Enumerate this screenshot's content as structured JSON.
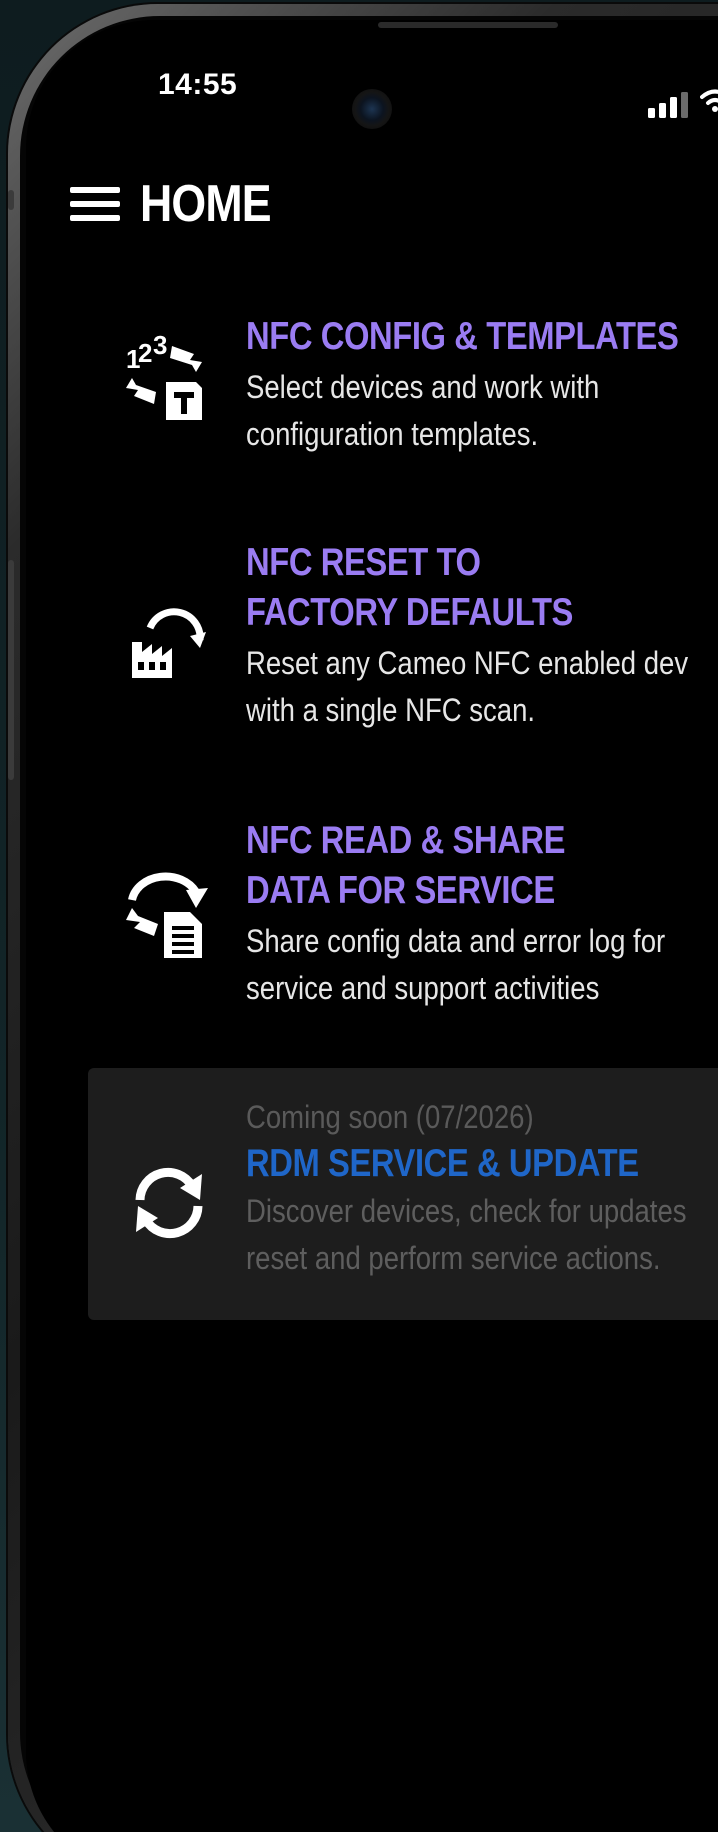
{
  "status_bar": {
    "time": "14:55"
  },
  "header": {
    "title": "HOME",
    "menu_icon": "hamburger-menu-icon"
  },
  "menu": {
    "items": [
      {
        "title": "NFC CONFIG & TEMPLATES",
        "description": "Select devices and work with\nconfiguration templates.",
        "icon": "numbers-template-icon"
      },
      {
        "title": "NFC RESET TO\nFACTORY DEFAULTS",
        "description": "Reset any Cameo NFC enabled dev\nwith a single NFC scan.",
        "icon": "factory-reset-icon"
      },
      {
        "title": "NFC READ & SHARE\nDATA FOR SERVICE",
        "description": "Share config data and error log for\nservice and support activities",
        "icon": "share-document-icon"
      }
    ],
    "coming_soon": {
      "label": "Coming soon (07/2026)",
      "title": "RDM SERVICE & UPDATE",
      "description": "Discover devices, check for updates\nreset and perform service actions.",
      "icon": "sync-icon"
    }
  },
  "colors": {
    "accent_purple": "#9a7cf2",
    "accent_blue": "#1f66c8",
    "background": "#000000",
    "card_disabled": "#1d1d1d"
  }
}
